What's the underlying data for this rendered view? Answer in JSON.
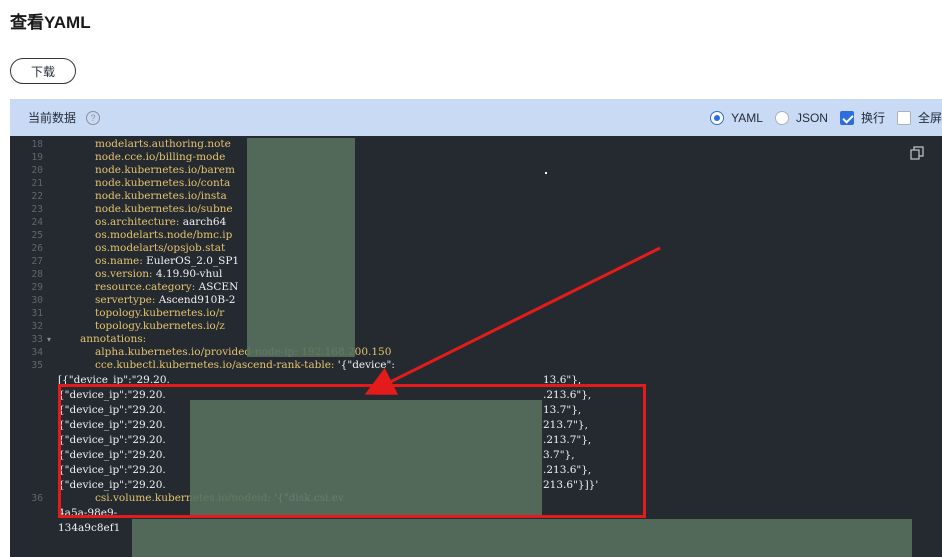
{
  "title": "查看YAML",
  "download_label": "下载",
  "toolbar": {
    "current_data_label": "当前数据",
    "help_icon": "question-circle-icon",
    "options": [
      {
        "label": "YAML",
        "kind": "radio",
        "checked": true
      },
      {
        "label": "JSON",
        "kind": "radio",
        "checked": false
      },
      {
        "label": "换行",
        "kind": "checkbox",
        "checked": true
      },
      {
        "label": "全屏",
        "kind": "checkbox",
        "checked": false
      }
    ]
  },
  "colors": {
    "toolbar_bg": "#c9dbf4",
    "editor_bg": "#252a31",
    "accent": "#2c6edd",
    "highlight_box": "#e31b1b",
    "arrow": "#e31b1b",
    "blur": "#58705f"
  },
  "code_lines": [
    {
      "n": "18",
      "text": "modelarts.authoring.note"
    },
    {
      "n": "19",
      "text": "node.cce.io/billing-mode"
    },
    {
      "n": "20",
      "text": "node.kubernetes.io/barem"
    },
    {
      "n": "21",
      "text": "node.kubernetes.io/conta"
    },
    {
      "n": "22",
      "text": "node.kubernetes.io/insta"
    },
    {
      "n": "23",
      "text": "node.kubernetes.io/subne"
    },
    {
      "n": "24",
      "key": "os.architecture: ",
      "val": "aarch64"
    },
    {
      "n": "25",
      "text": "os.modelarts.node/bmc.ip"
    },
    {
      "n": "26",
      "text": "os.modelarts/opsjob.stat"
    },
    {
      "n": "27",
      "key": "os.name: ",
      "val": "EulerOS_2.0_SP1"
    },
    {
      "n": "28",
      "key": "os.version: ",
      "val": "4.19.90-vhul"
    },
    {
      "n": "29",
      "key": "resource.category: ",
      "val": "ASCEN"
    },
    {
      "n": "30",
      "key": "servertype: ",
      "val": "Ascend910B-2"
    },
    {
      "n": "31",
      "text": "topology.kubernetes.io/r"
    },
    {
      "n": "32",
      "text": "topology.kubernetes.io/z"
    },
    {
      "n": "33",
      "text": "annotations:",
      "fold": "▾"
    },
    {
      "n": "34",
      "text": "alpha.kubernetes.io/provided-node-ip: 192.168.200.150"
    },
    {
      "n": "35",
      "key": "cce.kubectl.kubernetes.io/ascend-rank-table: ",
      "val": "'{\"device\":"
    },
    {
      "n": "",
      "val": "[{\"device_ip\":\"29.20.",
      "tail": "13.6\"},"
    },
    {
      "n": "",
      "val": "{\"device_ip\":\"29.20.",
      "tail": ".213.6\"},"
    },
    {
      "n": "",
      "val": "{\"device_ip\":\"29.20.",
      "tail": "13.7\"},"
    },
    {
      "n": "",
      "val": "{\"device_ip\":\"29.20.",
      "tail": "213.7\"},"
    },
    {
      "n": "",
      "val": "{\"device_ip\":\"29.20.",
      "tail": ".213.7\"},"
    },
    {
      "n": "",
      "val": "{\"device_ip\":\"29.20.",
      "tail": "3.7\"},"
    },
    {
      "n": "",
      "val": "{\"device_ip\":\"29.20.",
      "tail": ".213.6\"},"
    },
    {
      "n": "",
      "val": "{\"device_ip\":\"29.20.",
      "tail": "213.6\"}]}'"
    },
    {
      "n": "36",
      "key": "csi.volume.kubernetes.io/nodeid: ",
      "val": "'{\"disk.csi.ev"
    },
    {
      "n": "",
      "val": "4a5a-98e9-"
    },
    {
      "n": "",
      "val": "134a9c8ef1"
    }
  ]
}
